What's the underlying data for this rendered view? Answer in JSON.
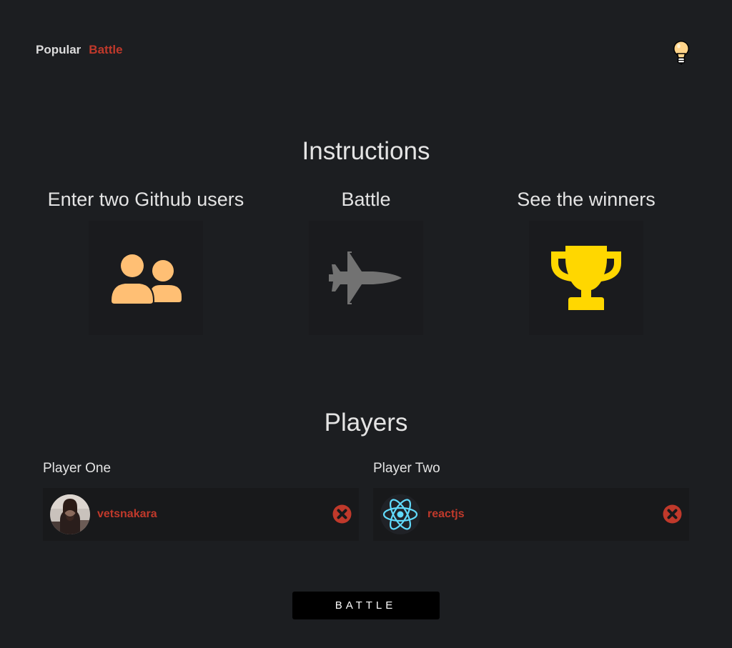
{
  "nav": {
    "items": [
      {
        "label": "Popular",
        "active": false
      },
      {
        "label": "Battle",
        "active": true
      }
    ]
  },
  "theme_toggle": {
    "icon": "lightbulb-icon"
  },
  "instructions": {
    "title": "Instructions",
    "steps": [
      {
        "label": "Enter two Github users",
        "icon": "users-icon",
        "color": "#ffbf74"
      },
      {
        "label": "Battle",
        "icon": "fighter-jet-icon",
        "color": "#727272"
      },
      {
        "label": "See the winners",
        "icon": "trophy-icon",
        "color": "#ffd700"
      }
    ]
  },
  "players": {
    "title": "Players",
    "player_one": {
      "label": "Player One",
      "username": "vetsnakara",
      "avatar": "user-photo-avatar"
    },
    "player_two": {
      "label": "Player Two",
      "username": "reactjs",
      "avatar": "react-logo-avatar"
    }
  },
  "battle_button": {
    "label": "BATTLE"
  },
  "colors": {
    "background": "#1c1e21",
    "accent": "#c0392b",
    "tile": "#1a1b1e",
    "card": "#18191b"
  }
}
